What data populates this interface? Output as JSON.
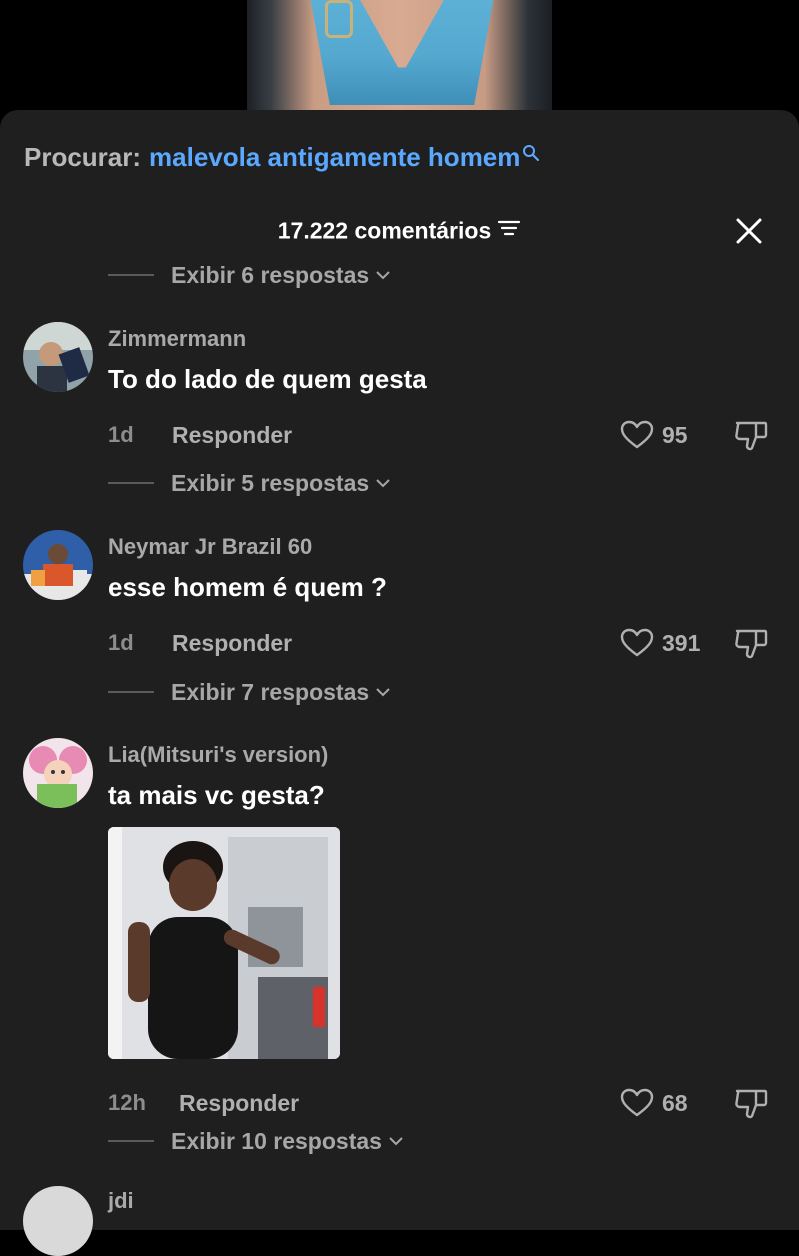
{
  "search": {
    "label": "Procurar:",
    "term": "malevola antigamente homem"
  },
  "comments_header": {
    "title": "17.222 comentários"
  },
  "top_replies": "Exibir 6 respostas",
  "comments": [
    {
      "username": "Zimmermann",
      "text": "To do lado de quem gesta",
      "time": "1d",
      "reply_label": "Responder",
      "likes": "95",
      "replies_label": "Exibir 5 respostas"
    },
    {
      "username": "Neymar Jr Brazil 60",
      "text": "esse homem é quem ?",
      "time": "1d",
      "reply_label": "Responder",
      "likes": "391",
      "replies_label": "Exibir 7 respostas"
    },
    {
      "username": "Lia(Mitsuri's version)",
      "text": "ta mais vc gesta?",
      "time": "12h",
      "reply_label": "Responder",
      "likes": "68",
      "replies_label": "Exibir 10 respostas"
    }
  ],
  "next_comment_partial_username": "jdi",
  "colors": {
    "accent_search": "#5ba8ff",
    "sheet_background": "#1f1f1f",
    "secondary_text": "#a9a9a9"
  }
}
